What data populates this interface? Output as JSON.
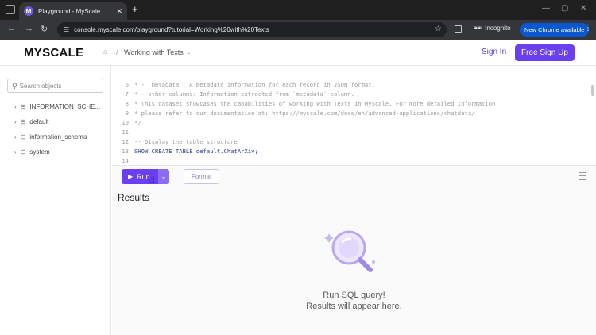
{
  "browser": {
    "tab_title": "Playground - MyScale",
    "tab_favicon_letter": "M",
    "url": "console.myscale.com/playground?tutorial=Working%20with%20Texts",
    "incognito_label": "Incognito",
    "update_label": "New Chrome available"
  },
  "header": {
    "logo": "MYSCALE",
    "breadcrumb": "Working with Texts",
    "signin": "Sign In",
    "signup": "Free Sign Up"
  },
  "sidebar": {
    "search_placeholder": "Search objects",
    "items": [
      {
        "label": "INFORMATION_SCHE..."
      },
      {
        "label": "default"
      },
      {
        "label": "information_schema"
      },
      {
        "label": "system"
      }
    ]
  },
  "editor": {
    "lines": [
      {
        "n": "6",
        "text": " * - `metadata`: A metadata information for each record in JSON format.",
        "kind": "comment"
      },
      {
        "n": "7",
        "text": " * - other columns: Information extracted from `metadata` column.",
        "kind": "comment"
      },
      {
        "n": "8",
        "text": " * This dataset showcases the capabilities of working with Texts in MyScale. For more detailed information,",
        "kind": "comment"
      },
      {
        "n": "9",
        "text": " * please refer to our documentation at: https://myscale.com/docs/en/advanced-applications/chatdata/",
        "kind": "comment"
      },
      {
        "n": "10",
        "text": " */",
        "kind": "comment"
      },
      {
        "n": "11",
        "text": "",
        "kind": "comment"
      },
      {
        "n": "12",
        "text": "-- Display the table structure",
        "kind": "comment"
      },
      {
        "n": "13",
        "text": "SHOW CREATE TABLE default.ChatArXiv;",
        "kind": "sql"
      },
      {
        "n": "14",
        "text": "",
        "kind": "comment"
      }
    ]
  },
  "actions": {
    "run": "Run",
    "format": "Format"
  },
  "results": {
    "title": "Results",
    "empty_line1": "Run SQL query!",
    "empty_line2": "Results will appear here."
  }
}
